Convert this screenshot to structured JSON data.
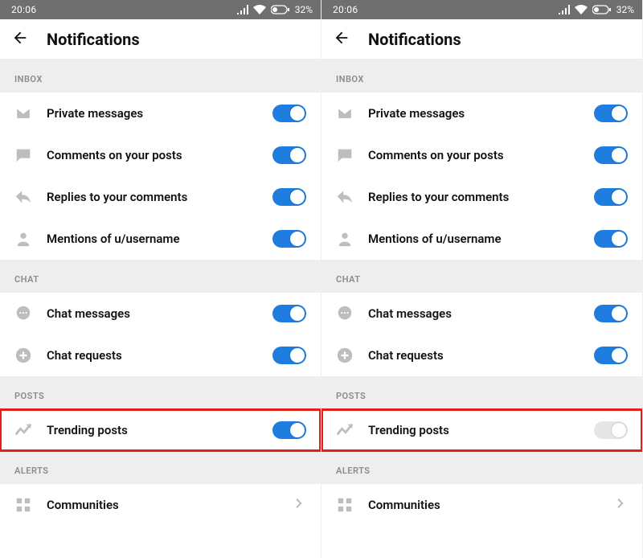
{
  "status": {
    "time": "20:06",
    "battery": "32%"
  },
  "header": {
    "title": "Notifications"
  },
  "sections": {
    "inbox": "INBOX",
    "chat": "CHAT",
    "posts": "POSTS",
    "alerts": "ALERTS"
  },
  "panels": [
    {
      "rows": {
        "private_messages": {
          "label": "Private messages",
          "on": true
        },
        "comments_posts": {
          "label": "Comments on your posts",
          "on": true
        },
        "replies": {
          "label": "Replies to your comments",
          "on": true
        },
        "mentions": {
          "label": "Mentions of u/username",
          "on": true
        },
        "chat_messages": {
          "label": "Chat messages",
          "on": true
        },
        "chat_requests": {
          "label": "Chat requests",
          "on": true
        },
        "trending": {
          "label": "Trending posts",
          "on": true
        },
        "communities": {
          "label": "Communities"
        }
      }
    },
    {
      "rows": {
        "private_messages": {
          "label": "Private messages",
          "on": true
        },
        "comments_posts": {
          "label": "Comments on your posts",
          "on": true
        },
        "replies": {
          "label": "Replies to your comments",
          "on": true
        },
        "mentions": {
          "label": "Mentions of u/username",
          "on": true
        },
        "chat_messages": {
          "label": "Chat messages",
          "on": true
        },
        "chat_requests": {
          "label": "Chat requests",
          "on": true
        },
        "trending": {
          "label": "Trending posts",
          "on": false
        },
        "communities": {
          "label": "Communities"
        }
      }
    }
  ]
}
